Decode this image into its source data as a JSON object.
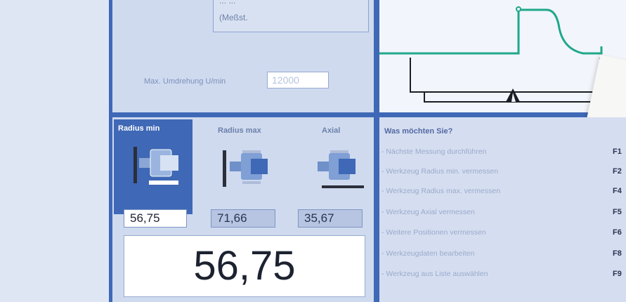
{
  "top_panel": {
    "box_line1": "... ...",
    "box_line2": "(Meßst.",
    "max_rpm_label": "Max. Umdrehung U/min",
    "max_rpm_value": "12000"
  },
  "measure": {
    "columns": [
      {
        "title": "Radius min",
        "value": "56,75",
        "selected": true
      },
      {
        "title": "Radius max",
        "value": "71,66",
        "selected": false
      },
      {
        "title": "Axial",
        "value": "35,67",
        "selected": false
      }
    ],
    "big_value": "56,75"
  },
  "menu": {
    "title": "Was möchten Sie?",
    "items": [
      {
        "label": "- Nächste Messung durchführen",
        "key": "F1"
      },
      {
        "label": "- Werkzeug Radius min. vermessen",
        "key": "F2"
      },
      {
        "label": "- Werkzeug Radius max. vermessen",
        "key": "F4"
      },
      {
        "label": "- Werkzeug Axial vermessen",
        "key": "F5"
      },
      {
        "label": "- Weitere Positionen vermessen",
        "key": "F6"
      },
      {
        "label": "- Werkzeugdaten bearbeiten",
        "key": "F8"
      },
      {
        "label": "- Werkzeug aus Liste auswählen",
        "key": "F9"
      }
    ]
  },
  "colors": {
    "frame": "#3f68b6",
    "profile_line": "#1fa88a",
    "panel_bg": "#cfdaef"
  }
}
